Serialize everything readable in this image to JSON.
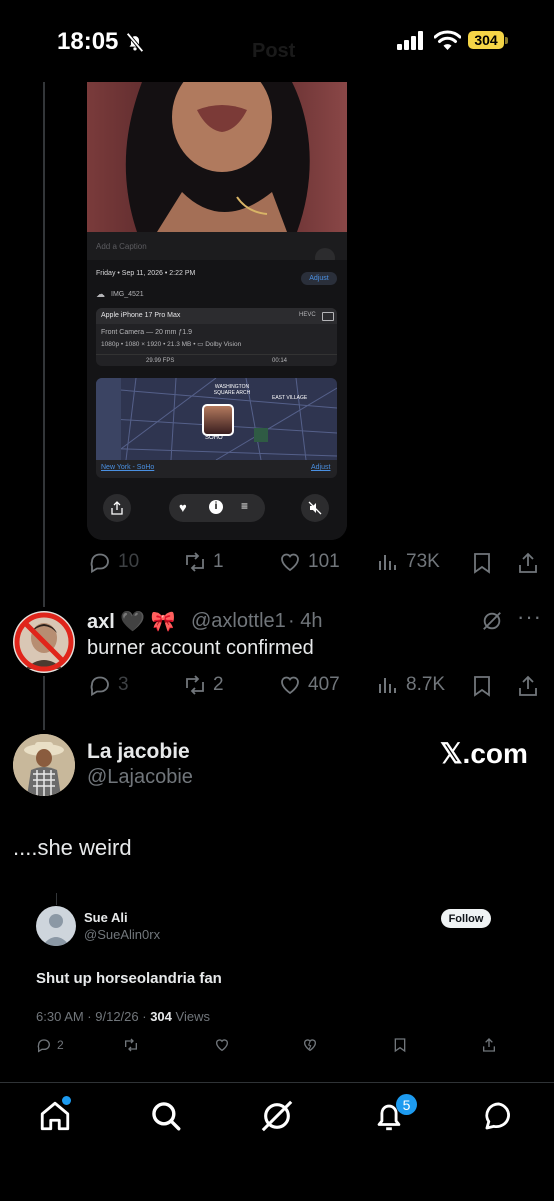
{
  "status_bar": {
    "time": "18:05",
    "battery": "304",
    "page_title": "Post"
  },
  "embedded_media": {
    "caption_placeholder": "Add a Caption",
    "date_line": "Friday • Sep 11, 2026 • 2:22 PM",
    "adjust_label": "Adjust",
    "file_name": "IMG_4521",
    "device": "Apple iPhone 17 Pro Max",
    "format_badge": "HEVC",
    "camera_line": "Front Camera — 20 mm ƒ1.9",
    "video_specs": "1080p • 1080 × 1920 • 21.3 MB • ▭ Dolby Vision",
    "fps": "29.99 FPS",
    "duration": "00:14",
    "map_labels": [
      "WASHINGTON SQUARE ARCH",
      "EAST VILLAGE",
      "SOHO"
    ],
    "location": "New York - SoHo",
    "location_adjust": "Adjust"
  },
  "post1_stats": {
    "replies": "10",
    "reposts": "1",
    "likes": "101",
    "views": "73K"
  },
  "reply": {
    "display_name": "axl 🖤 🎀",
    "handle": "@axlottle1",
    "time": "· 4h",
    "text": "burner account confirmed",
    "stats": {
      "replies": "3",
      "reposts": "2",
      "likes": "407",
      "views": "8.7K"
    }
  },
  "quoted_author": {
    "display_name": "La jacobie",
    "handle": "@Lajacobie",
    "brand": "𝕏.com"
  },
  "quote_text": "....she weird",
  "inner_tweet": {
    "name": "Sue Ali",
    "handle": "@SueAlin0rx",
    "follow_label": "Follow",
    "text": "Shut up horseolandria fan",
    "meta_time": "6:30 AM · 9/12/26 ·",
    "views_count": "304",
    "views_label": "Views",
    "replies": "2"
  },
  "tab_bar": {
    "notification_badge": "5"
  },
  "colors": {
    "background": "#000000",
    "muted": "#71767b",
    "text": "#e7e9ea",
    "accent": "#1d9bf0",
    "battery": "#f5d547"
  }
}
